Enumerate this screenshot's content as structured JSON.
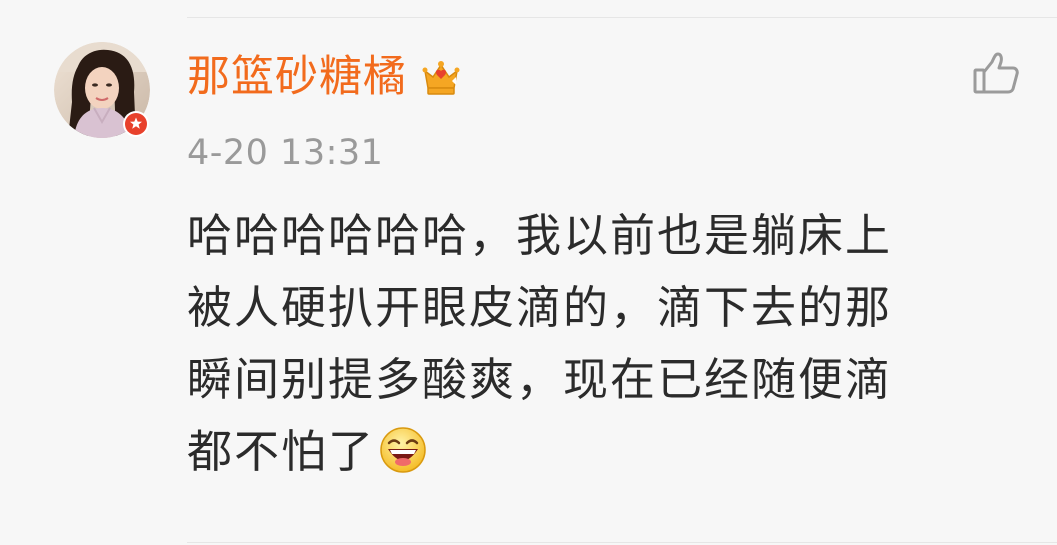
{
  "comment": {
    "username": "那篮砂糖橘",
    "timestamp": "4-20 13:31",
    "body": "哈哈哈哈哈哈，我以前也是躺床上\n被人硬扒开眼皮滴的，滴下去的那\n瞬间别提多酸爽，现在已经随便滴\n都不怕了",
    "icons": {
      "avatar": "user-avatar-photo",
      "badge": "verified-badge-icon",
      "member": "crown-icon",
      "like": "thumbs-up-icon",
      "emoji": "laughing-emoji-icon"
    },
    "colors": {
      "username": "#f26b1d",
      "timestamp": "#9a9a9a",
      "body": "#2b2b2b",
      "background": "#f7f7f7"
    }
  }
}
